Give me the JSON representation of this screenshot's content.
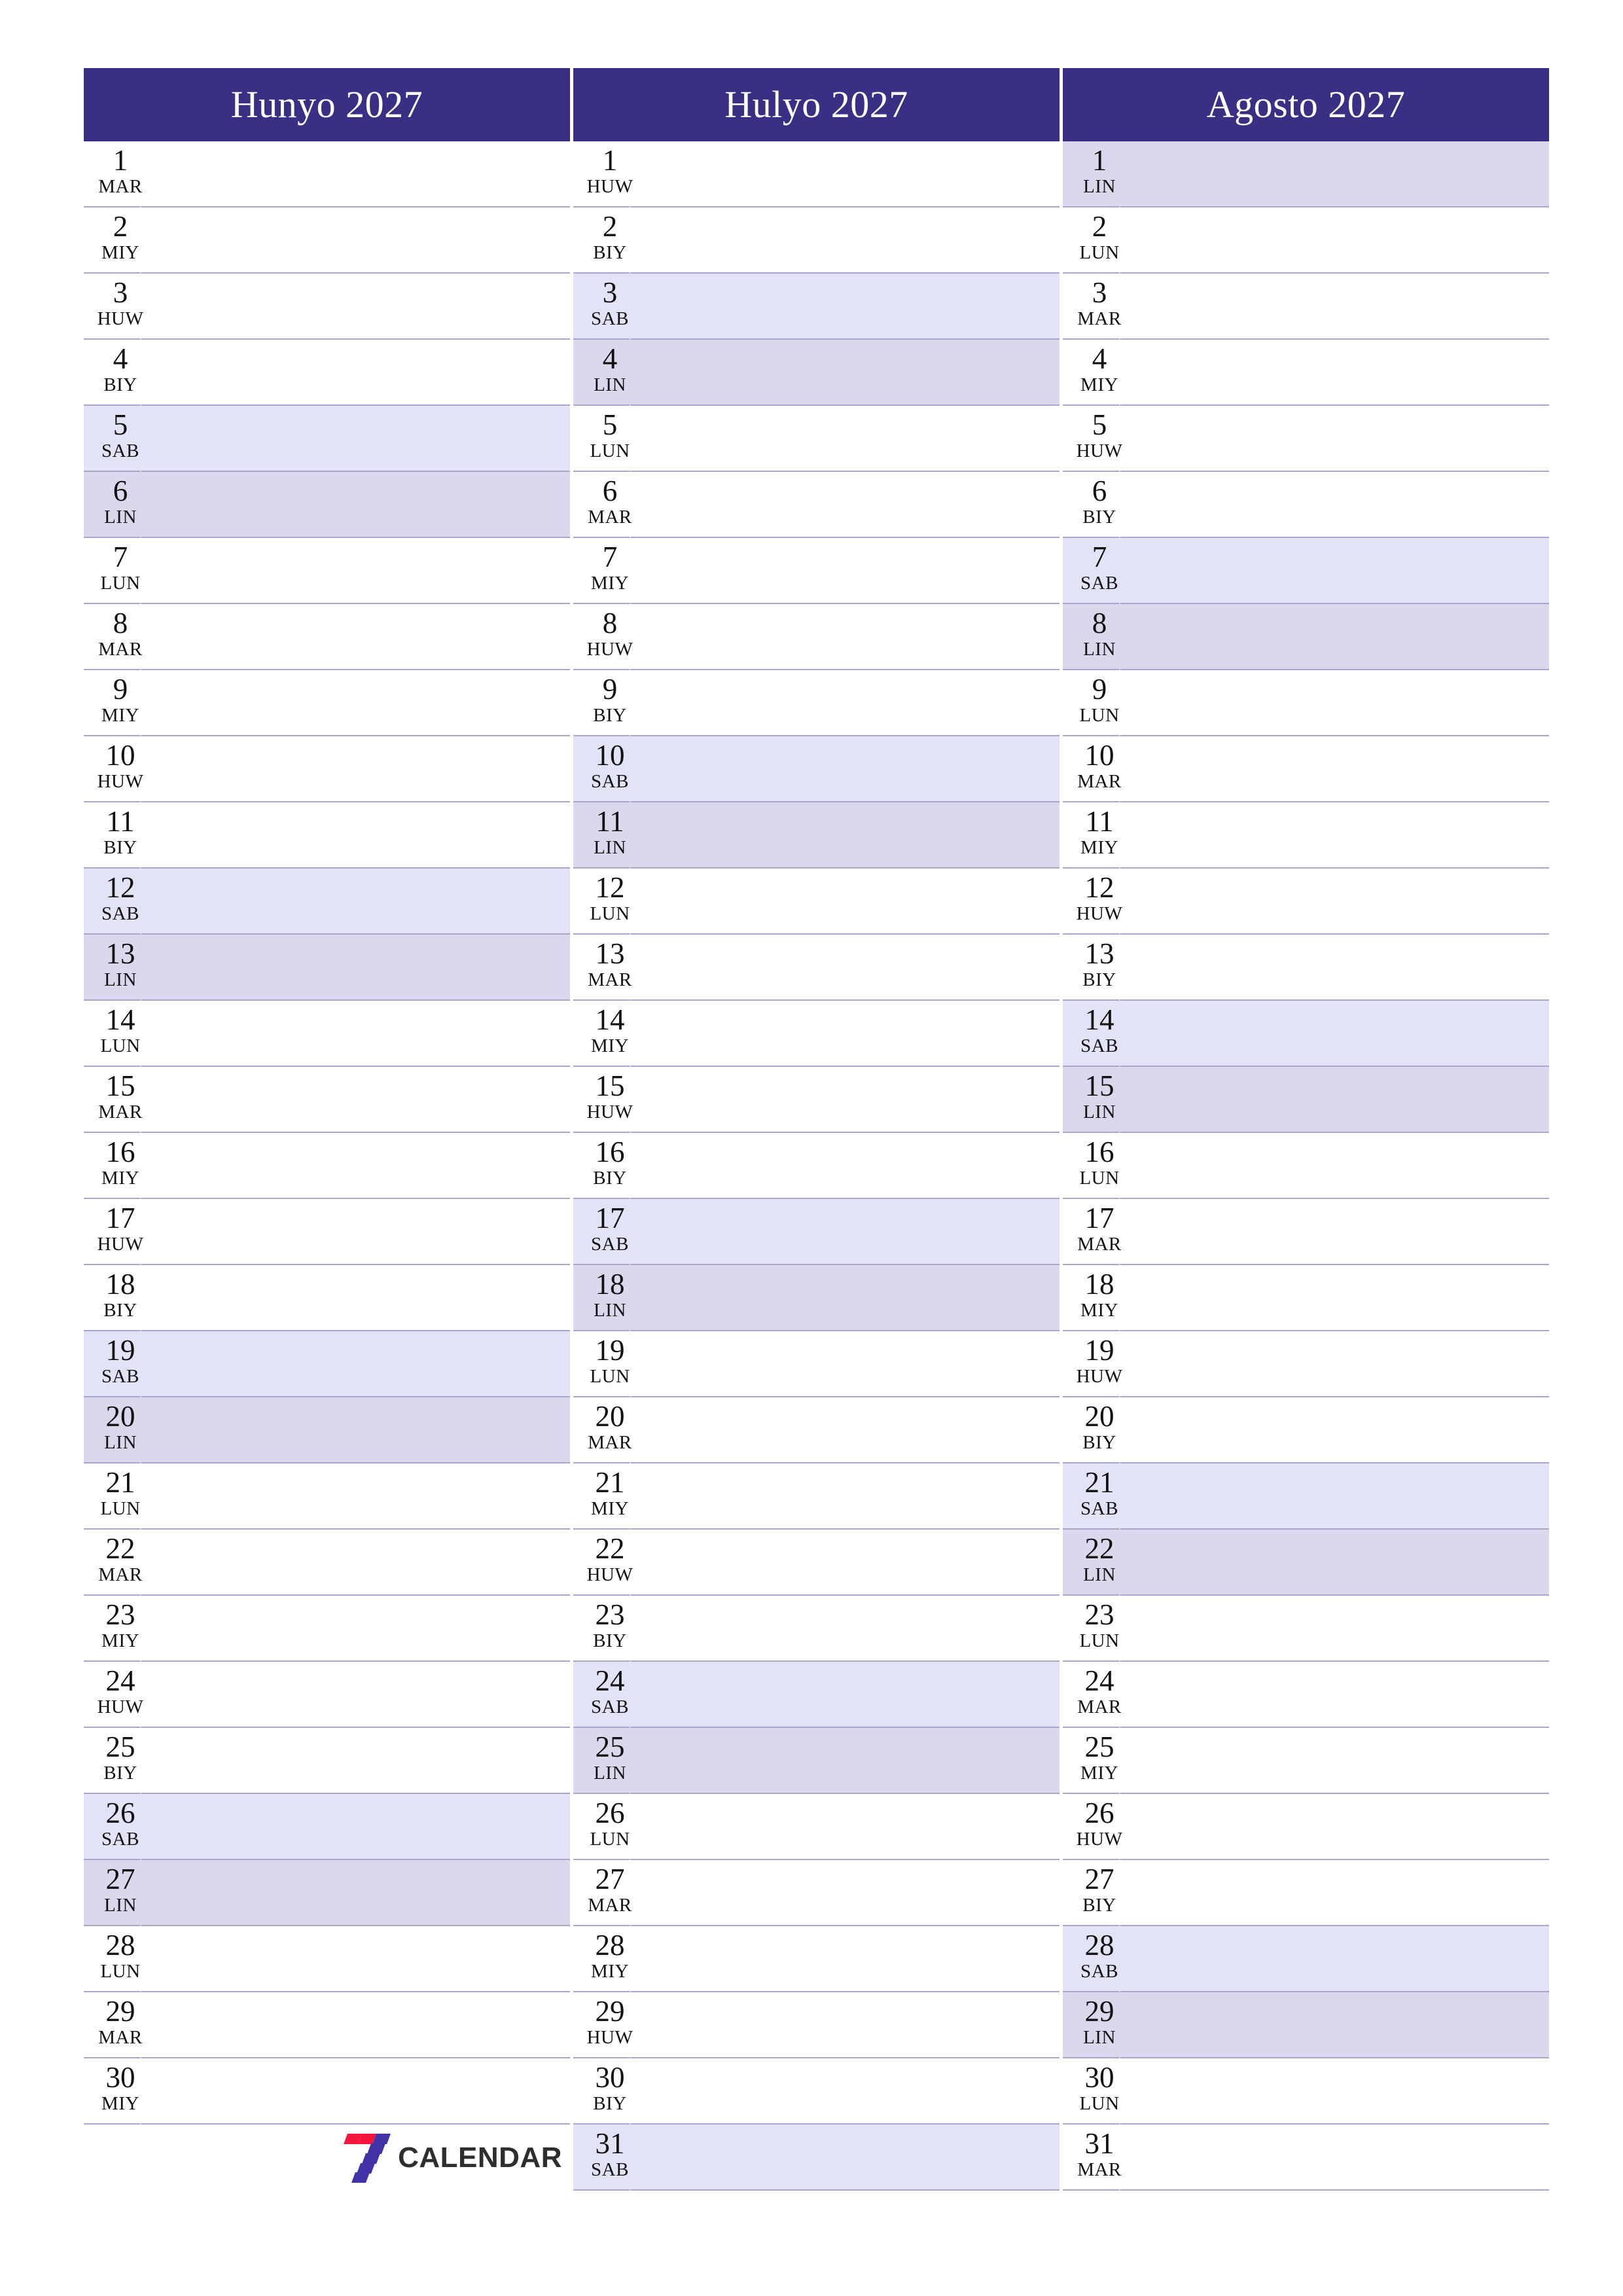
{
  "page": {
    "language": "Filipino (Tagalog)",
    "layout": "three-month vertical planner",
    "background_color": "#ffffff"
  },
  "theme": {
    "header_background": "#393086",
    "header_text": "#ffffff",
    "saturday_background": "#e3e3f7",
    "sunday_background": "#dbd7ec",
    "row_separator": "#a9a6cc",
    "day_text": "#111111"
  },
  "weekday_abbreviations": {
    "monday": "LUN",
    "tuesday": "MAR",
    "wednesday": "MIY",
    "thursday": "HUW",
    "friday": "BIY",
    "saturday": "SAB",
    "sunday": "LIN"
  },
  "brand": {
    "mark_name": "seven-logo-icon",
    "text": "CALENDAR",
    "mark_colors": [
      "#f4163c",
      "#4232a8"
    ]
  },
  "months": [
    {
      "title": "Hunyo 2027",
      "days": [
        {
          "num": "1",
          "wd": "MAR",
          "type": "weekday"
        },
        {
          "num": "2",
          "wd": "MIY",
          "type": "weekday"
        },
        {
          "num": "3",
          "wd": "HUW",
          "type": "weekday"
        },
        {
          "num": "4",
          "wd": "BIY",
          "type": "weekday"
        },
        {
          "num": "5",
          "wd": "SAB",
          "type": "saturday"
        },
        {
          "num": "6",
          "wd": "LIN",
          "type": "sunday"
        },
        {
          "num": "7",
          "wd": "LUN",
          "type": "weekday"
        },
        {
          "num": "8",
          "wd": "MAR",
          "type": "weekday"
        },
        {
          "num": "9",
          "wd": "MIY",
          "type": "weekday"
        },
        {
          "num": "10",
          "wd": "HUW",
          "type": "weekday"
        },
        {
          "num": "11",
          "wd": "BIY",
          "type": "weekday"
        },
        {
          "num": "12",
          "wd": "SAB",
          "type": "saturday"
        },
        {
          "num": "13",
          "wd": "LIN",
          "type": "sunday"
        },
        {
          "num": "14",
          "wd": "LUN",
          "type": "weekday"
        },
        {
          "num": "15",
          "wd": "MAR",
          "type": "weekday"
        },
        {
          "num": "16",
          "wd": "MIY",
          "type": "weekday"
        },
        {
          "num": "17",
          "wd": "HUW",
          "type": "weekday"
        },
        {
          "num": "18",
          "wd": "BIY",
          "type": "weekday"
        },
        {
          "num": "19",
          "wd": "SAB",
          "type": "saturday"
        },
        {
          "num": "20",
          "wd": "LIN",
          "type": "sunday"
        },
        {
          "num": "21",
          "wd": "LUN",
          "type": "weekday"
        },
        {
          "num": "22",
          "wd": "MAR",
          "type": "weekday"
        },
        {
          "num": "23",
          "wd": "MIY",
          "type": "weekday"
        },
        {
          "num": "24",
          "wd": "HUW",
          "type": "weekday"
        },
        {
          "num": "25",
          "wd": "BIY",
          "type": "weekday"
        },
        {
          "num": "26",
          "wd": "SAB",
          "type": "saturday"
        },
        {
          "num": "27",
          "wd": "LIN",
          "type": "sunday"
        },
        {
          "num": "28",
          "wd": "LUN",
          "type": "weekday"
        },
        {
          "num": "29",
          "wd": "MAR",
          "type": "weekday"
        },
        {
          "num": "30",
          "wd": "MIY",
          "type": "weekday"
        }
      ],
      "has_brand_slot": true
    },
    {
      "title": "Hulyo 2027",
      "days": [
        {
          "num": "1",
          "wd": "HUW",
          "type": "weekday"
        },
        {
          "num": "2",
          "wd": "BIY",
          "type": "weekday"
        },
        {
          "num": "3",
          "wd": "SAB",
          "type": "saturday"
        },
        {
          "num": "4",
          "wd": "LIN",
          "type": "sunday"
        },
        {
          "num": "5",
          "wd": "LUN",
          "type": "weekday"
        },
        {
          "num": "6",
          "wd": "MAR",
          "type": "weekday"
        },
        {
          "num": "7",
          "wd": "MIY",
          "type": "weekday"
        },
        {
          "num": "8",
          "wd": "HUW",
          "type": "weekday"
        },
        {
          "num": "9",
          "wd": "BIY",
          "type": "weekday"
        },
        {
          "num": "10",
          "wd": "SAB",
          "type": "saturday"
        },
        {
          "num": "11",
          "wd": "LIN",
          "type": "sunday"
        },
        {
          "num": "12",
          "wd": "LUN",
          "type": "weekday"
        },
        {
          "num": "13",
          "wd": "MAR",
          "type": "weekday"
        },
        {
          "num": "14",
          "wd": "MIY",
          "type": "weekday"
        },
        {
          "num": "15",
          "wd": "HUW",
          "type": "weekday"
        },
        {
          "num": "16",
          "wd": "BIY",
          "type": "weekday"
        },
        {
          "num": "17",
          "wd": "SAB",
          "type": "saturday"
        },
        {
          "num": "18",
          "wd": "LIN",
          "type": "sunday"
        },
        {
          "num": "19",
          "wd": "LUN",
          "type": "weekday"
        },
        {
          "num": "20",
          "wd": "MAR",
          "type": "weekday"
        },
        {
          "num": "21",
          "wd": "MIY",
          "type": "weekday"
        },
        {
          "num": "22",
          "wd": "HUW",
          "type": "weekday"
        },
        {
          "num": "23",
          "wd": "BIY",
          "type": "weekday"
        },
        {
          "num": "24",
          "wd": "SAB",
          "type": "saturday"
        },
        {
          "num": "25",
          "wd": "LIN",
          "type": "sunday"
        },
        {
          "num": "26",
          "wd": "LUN",
          "type": "weekday"
        },
        {
          "num": "27",
          "wd": "MAR",
          "type": "weekday"
        },
        {
          "num": "28",
          "wd": "MIY",
          "type": "weekday"
        },
        {
          "num": "29",
          "wd": "HUW",
          "type": "weekday"
        },
        {
          "num": "30",
          "wd": "BIY",
          "type": "weekday"
        },
        {
          "num": "31",
          "wd": "SAB",
          "type": "saturday"
        }
      ],
      "has_brand_slot": false
    },
    {
      "title": "Agosto 2027",
      "days": [
        {
          "num": "1",
          "wd": "LIN",
          "type": "sunday"
        },
        {
          "num": "2",
          "wd": "LUN",
          "type": "weekday"
        },
        {
          "num": "3",
          "wd": "MAR",
          "type": "weekday"
        },
        {
          "num": "4",
          "wd": "MIY",
          "type": "weekday"
        },
        {
          "num": "5",
          "wd": "HUW",
          "type": "weekday"
        },
        {
          "num": "6",
          "wd": "BIY",
          "type": "weekday"
        },
        {
          "num": "7",
          "wd": "SAB",
          "type": "saturday"
        },
        {
          "num": "8",
          "wd": "LIN",
          "type": "sunday"
        },
        {
          "num": "9",
          "wd": "LUN",
          "type": "weekday"
        },
        {
          "num": "10",
          "wd": "MAR",
          "type": "weekday"
        },
        {
          "num": "11",
          "wd": "MIY",
          "type": "weekday"
        },
        {
          "num": "12",
          "wd": "HUW",
          "type": "weekday"
        },
        {
          "num": "13",
          "wd": "BIY",
          "type": "weekday"
        },
        {
          "num": "14",
          "wd": "SAB",
          "type": "saturday"
        },
        {
          "num": "15",
          "wd": "LIN",
          "type": "sunday"
        },
        {
          "num": "16",
          "wd": "LUN",
          "type": "weekday"
        },
        {
          "num": "17",
          "wd": "MAR",
          "type": "weekday"
        },
        {
          "num": "18",
          "wd": "MIY",
          "type": "weekday"
        },
        {
          "num": "19",
          "wd": "HUW",
          "type": "weekday"
        },
        {
          "num": "20",
          "wd": "BIY",
          "type": "weekday"
        },
        {
          "num": "21",
          "wd": "SAB",
          "type": "saturday"
        },
        {
          "num": "22",
          "wd": "LIN",
          "type": "sunday"
        },
        {
          "num": "23",
          "wd": "LUN",
          "type": "weekday"
        },
        {
          "num": "24",
          "wd": "MAR",
          "type": "weekday"
        },
        {
          "num": "25",
          "wd": "MIY",
          "type": "weekday"
        },
        {
          "num": "26",
          "wd": "HUW",
          "type": "weekday"
        },
        {
          "num": "27",
          "wd": "BIY",
          "type": "weekday"
        },
        {
          "num": "28",
          "wd": "SAB",
          "type": "saturday"
        },
        {
          "num": "29",
          "wd": "LIN",
          "type": "sunday"
        },
        {
          "num": "30",
          "wd": "LUN",
          "type": "weekday"
        },
        {
          "num": "31",
          "wd": "MAR",
          "type": "weekday"
        }
      ],
      "has_brand_slot": false
    }
  ]
}
